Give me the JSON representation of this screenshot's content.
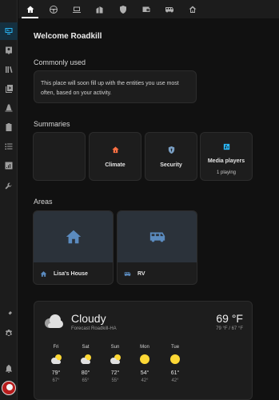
{
  "header": {
    "tabs": [
      {
        "icon": "home-icon"
      },
      {
        "icon": "steering-wheel-icon"
      },
      {
        "icon": "laptop-icon"
      },
      {
        "icon": "buildings-icon"
      },
      {
        "icon": "shield-icon"
      },
      {
        "icon": "wallet-icon"
      },
      {
        "icon": "rv-icon"
      },
      {
        "icon": "house-outline-icon"
      }
    ]
  },
  "sidebar": {
    "items": [
      "overview-icon",
      "map-person-icon",
      "logbook-icon",
      "media-icon",
      "energy-cone-icon",
      "clipboard-icon",
      "todo-list-icon",
      "history-chart-icon",
      "wrench-icon"
    ],
    "bottom": [
      "developer-tools-icon",
      "settings-gear-icon",
      "notifications-bell-icon"
    ]
  },
  "welcome": "Welcome Roadkill",
  "commonly_used": {
    "title": "Commonly used",
    "text": "This place will soon fill up with the entities you use most often, based on your activity."
  },
  "summaries": {
    "title": "Summaries",
    "tiles": [
      {
        "label": "",
        "sub": ""
      },
      {
        "label": "Climate",
        "sub": "",
        "icon": "climate-house-icon",
        "color": "#ff7043"
      },
      {
        "label": "Security",
        "sub": "",
        "icon": "shield-icon",
        "color": "#7a9fc4"
      },
      {
        "label": "Media players",
        "sub": "1 playing",
        "icon": "media-player-icon",
        "color": "#29b6f6"
      }
    ]
  },
  "areas": {
    "title": "Areas",
    "items": [
      {
        "name": "Lisa's House",
        "icon": "house-icon"
      },
      {
        "name": "RV",
        "icon": "rv-icon"
      }
    ],
    "accent": "#5b8bbf"
  },
  "weather": {
    "condition": "Cloudy",
    "forecast_label": "Forecast Roadkill-HA",
    "temperature": "69 °F",
    "hi_lo": "79 °F / 67 °F",
    "days": [
      {
        "day": "Fri",
        "icon": "partly-cloudy-icon",
        "high": "79°",
        "low": "67°"
      },
      {
        "day": "Sat",
        "icon": "partly-cloudy-icon",
        "high": "80°",
        "low": "65°"
      },
      {
        "day": "Sun",
        "icon": "partly-cloudy-icon",
        "high": "72°",
        "low": "55°"
      },
      {
        "day": "Mon",
        "icon": "sunny-icon",
        "high": "54°",
        "low": "42°"
      },
      {
        "day": "Tue",
        "icon": "sunny-icon",
        "high": "61°",
        "low": "42°"
      }
    ]
  }
}
